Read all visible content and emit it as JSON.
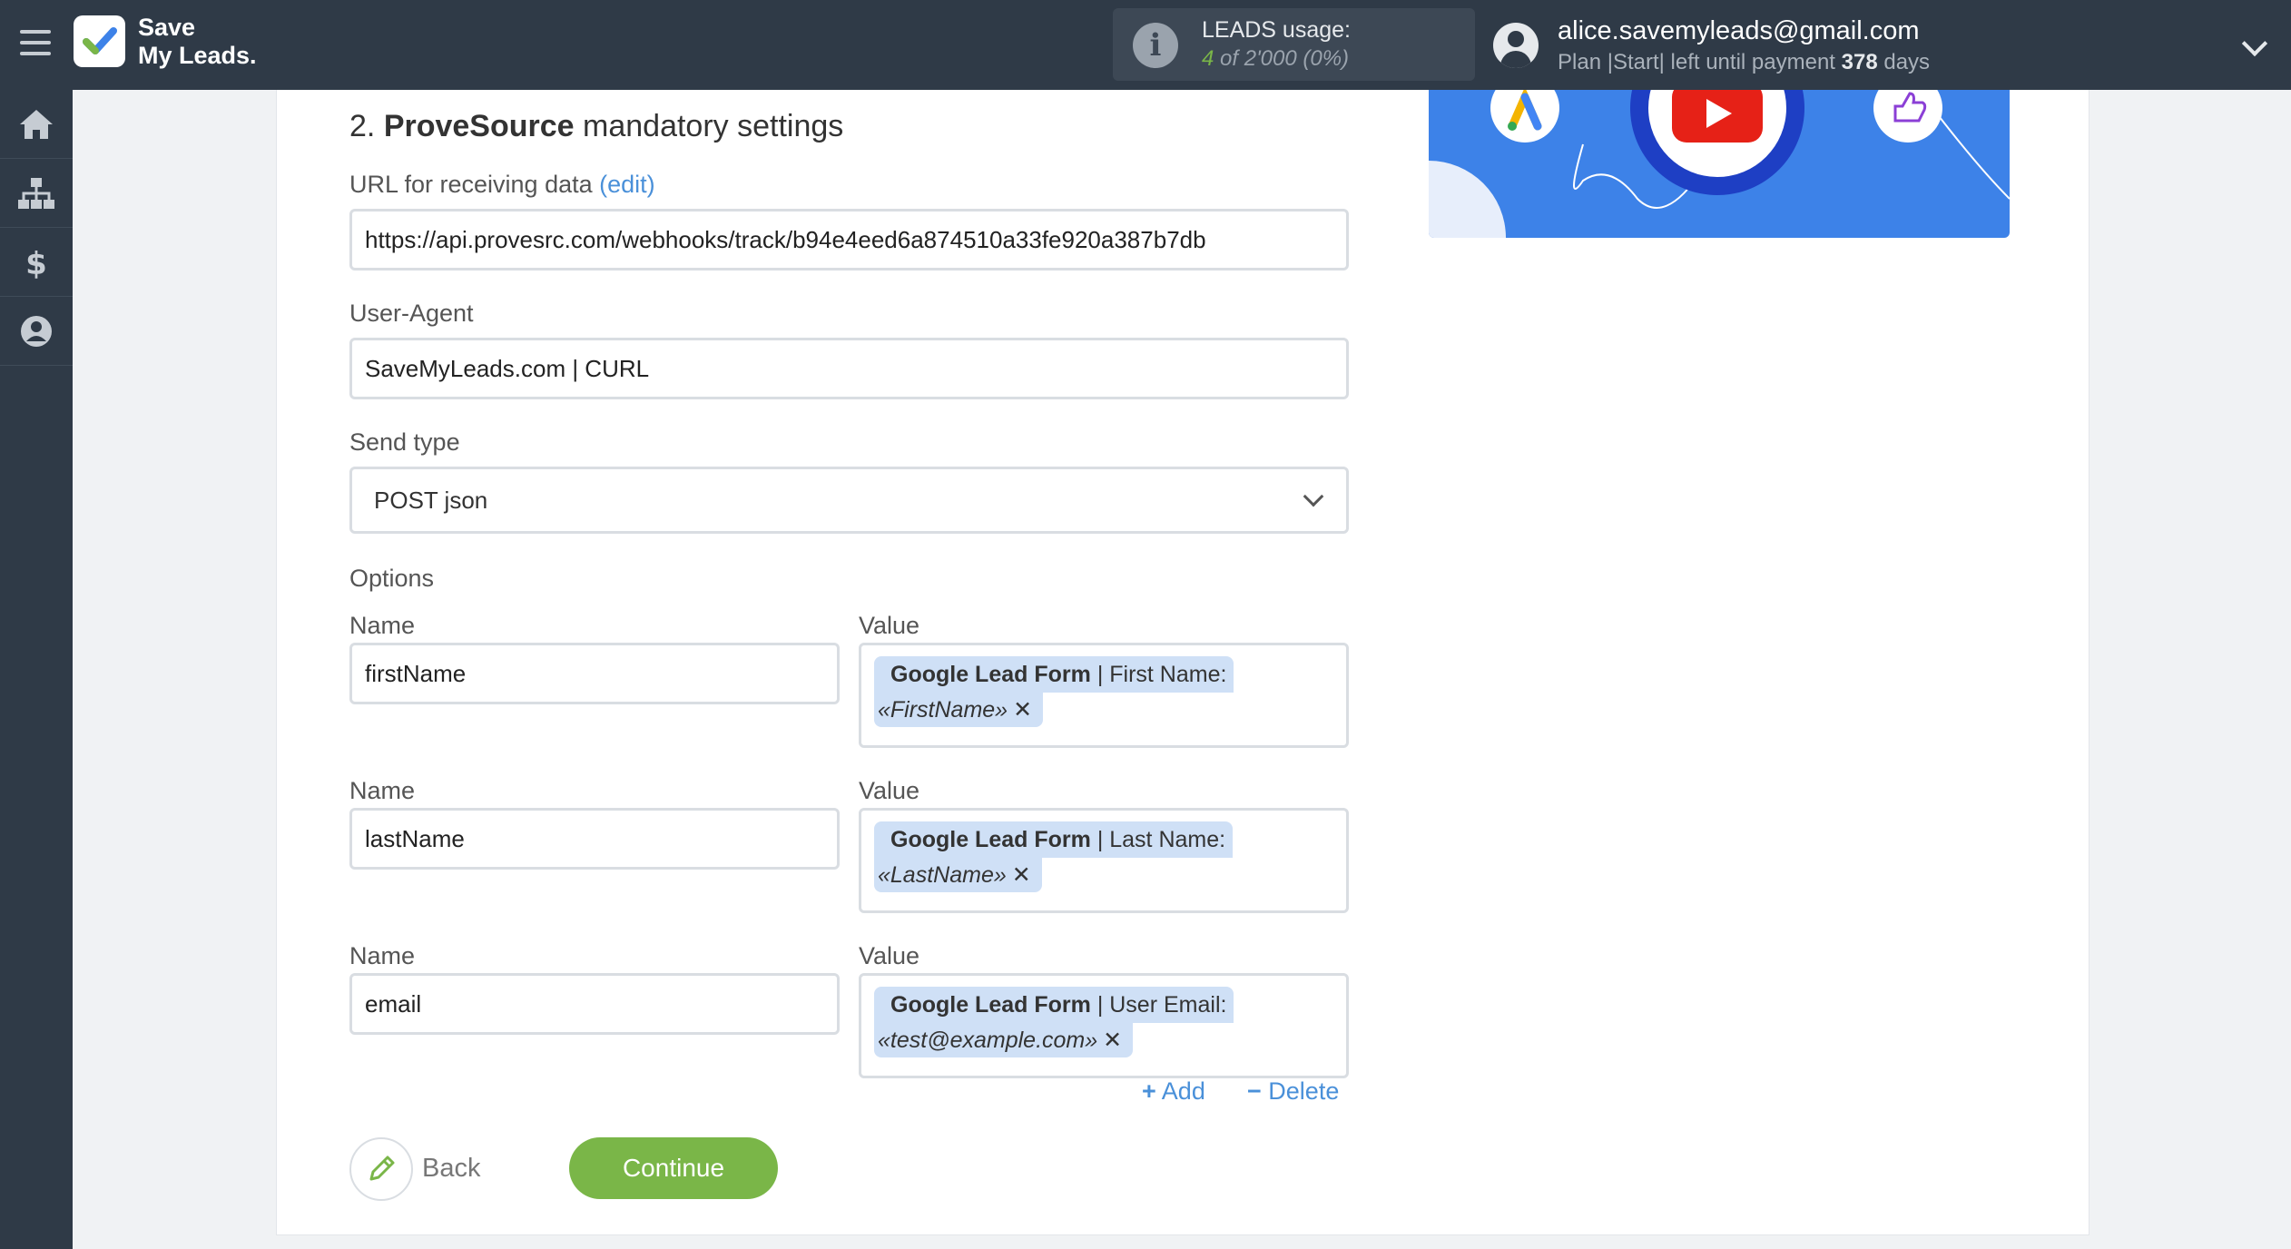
{
  "header": {
    "logo_line1": "Save",
    "logo_line2": "My Leads.",
    "usage_label": "LEADS usage:",
    "usage_count": "4",
    "usage_of": "of 2'000",
    "usage_pct": "(0%)",
    "user_email": "alice.savemyleads@gmail.com",
    "plan_prefix": "Plan |Start| left until payment",
    "plan_days": "378",
    "plan_suffix": "days"
  },
  "sidebar": {
    "items": [
      {
        "icon": "home-icon"
      },
      {
        "icon": "sitemap-icon"
      },
      {
        "icon": "dollar-icon"
      },
      {
        "icon": "user-icon"
      }
    ]
  },
  "form": {
    "title_num": "2.",
    "title_service": "ProveSource",
    "title_rest": "mandatory settings",
    "url_label": "URL for receiving data",
    "url_edit": "(edit)",
    "url_value": "https://api.provesrc.com/webhooks/track/b94e4eed6a874510a33fe920a387b7db",
    "ua_label": "User-Agent",
    "ua_value": "SaveMyLeads.com | CURL",
    "send_type_label": "Send type",
    "send_type_value": "POST json",
    "options_label": "Options",
    "name_label": "Name",
    "value_label": "Value",
    "options": [
      {
        "name": "firstName",
        "chip_source": "Google Lead Form",
        "chip_field": "| First Name:",
        "chip_value": "«FirstName»"
      },
      {
        "name": "lastName",
        "chip_source": "Google Lead Form",
        "chip_field": "| Last Name:",
        "chip_value": "«LastName»"
      },
      {
        "name": "email",
        "chip_source": "Google Lead Form",
        "chip_field": "| User Email:",
        "chip_value": "«test@example.com»"
      }
    ],
    "add_label": "Add",
    "delete_label": "Delete",
    "back_label": "Back",
    "continue_label": "Continue"
  },
  "colors": {
    "topbar": "#2f3a47",
    "accent_green": "#7ab648",
    "link_blue": "#4a90d9",
    "chip_bg": "#cfe0f6"
  }
}
